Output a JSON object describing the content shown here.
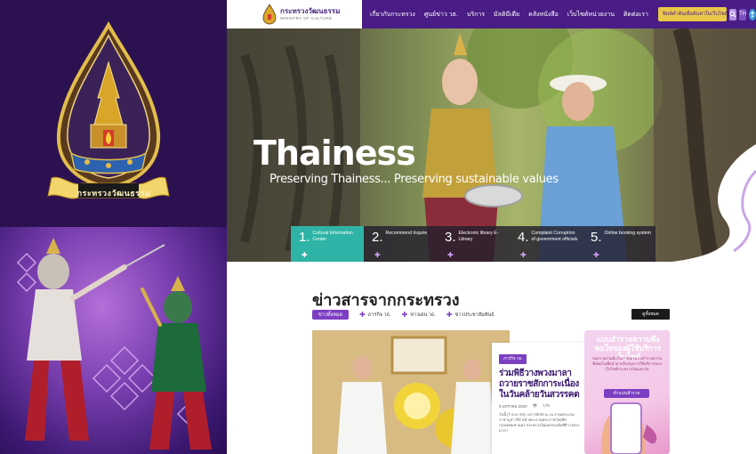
{
  "branding": {
    "seal_caption": "กระทรวงวัฒนธรรม"
  },
  "header": {
    "logo_th": "กระทรวงวัฒนธรรม",
    "logo_en": "MINISTRY OF CULTURE",
    "menu": [
      "เกี่ยวกับกระทรวง",
      "ศูนย์ข่าว วธ.",
      "บริการ",
      "มัลติมีเดีย",
      "คลังหนังสือ",
      "เว็บไซต์หน่วยงาน",
      "ติดต่อเรา"
    ],
    "search_placeholder": "พิมพ์คำค้นเพื่อค้นหาในเว็บไซต์ กระทรวงวัฒนธรรม",
    "lang_label": "TH",
    "icons": [
      "search-icon",
      "accessibility-icon"
    ]
  },
  "hero": {
    "logo_text": "Thainess",
    "subtitle": "Preserving Thainess... Preserving sustainable values"
  },
  "services": [
    {
      "num": "1.",
      "label": "Cultural Information Center"
    },
    {
      "num": "2.",
      "label": "Recommend Inquire"
    },
    {
      "num": "3.",
      "label": "Electronic library E-Library"
    },
    {
      "num": "4.",
      "label": "Complaint Corruption of government officials"
    },
    {
      "num": "5.",
      "label": "Online booking system"
    }
  ],
  "news": {
    "title": "ข่าวสารจากกระทรวง",
    "tabs": [
      "ข่าวทั้งหมด",
      "ภารกิจ วธ.",
      "ข่าวเด่น วธ.",
      "ข่าวประชาสัมพันธ์"
    ],
    "all_button": "ดูทั้งหมด",
    "card": {
      "badge": "ภารกิจ วธ.",
      "title": "ร่วมพิธีวางพวงมาลาถวายราชสักการะเนื่องในวันคล้ายวันสวรรคต",
      "date": "8 มกราคม 2020",
      "views": "176",
      "excerpt": "วันนี้ (7 ต.ค. 64) เวลา 08.00 น. ณ ลานพระบรมราชานุสาวรีย์ หน้าพระลานพระราชวังดุสิต กรุงเทพมหานคร กระทรวงวัฒนธรรมจัดพิธีวางพวงมาลา"
    }
  },
  "survey": {
    "title": "แบบสำรวจความพึงพอใจของผู้ใช้บริการเว็บไซต์",
    "text": "ขอความร่วมมือในการตอบแบบสำรวจความพึงพอใจเพื่อนำมาปรับปรุงการให้บริการของเว็บไซต์กระทรวงวัฒนธรรม",
    "button": "ทำแบบสำรวจ"
  },
  "colors": {
    "brand_purple": "#4a1c85",
    "accent_teal": "#2fb3a6",
    "accent_gold": "#e9c84a"
  }
}
